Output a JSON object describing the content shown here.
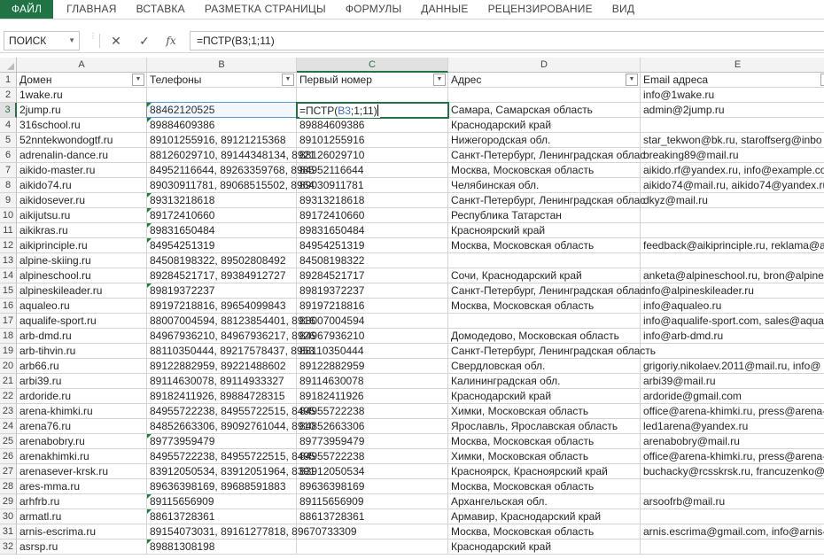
{
  "ribbon": {
    "tabs": [
      "ФАЙЛ",
      "ГЛАВНАЯ",
      "ВСТАВКА",
      "РАЗМЕТКА СТРАНИЦЫ",
      "ФОРМУЛЫ",
      "ДАННЫЕ",
      "РЕЦЕНЗИРОВАНИЕ",
      "ВИД"
    ]
  },
  "formula_bar": {
    "name_box": "ПОИСК",
    "cancel_icon": "close-icon",
    "enter_icon": "check-icon",
    "fx_label": "fx",
    "formula": "=ПСТР(B3;1;11)"
  },
  "sheet": {
    "columns": [
      "A",
      "B",
      "C",
      "D",
      "E"
    ],
    "selected_column": "C",
    "selected_row": 3,
    "active_cell": "C3",
    "colors": {
      "accent": "#217346",
      "reference": "#4472c4",
      "error_indicator": "#1e7b3a"
    },
    "headers": [
      "Домен",
      "Телефоны",
      "Первый номер",
      "Адрес",
      "Email адреса"
    ],
    "editing_formula": {
      "prefix": "=ПСТР(",
      "ref": "B3",
      "suffix": ";1;11)"
    },
    "rows": [
      {
        "n": 2,
        "a": "1wake.ru",
        "b": "",
        "c": "",
        "d": "",
        "e": "info@1wake.ru",
        "err": false
      },
      {
        "n": 3,
        "a": "2jump.ru",
        "b": "88462120525",
        "c": "",
        "d": "Самара, Самарская область",
        "e": "admin@2jump.ru",
        "err": true
      },
      {
        "n": 4,
        "a": "316school.ru",
        "b": "89884609386",
        "c": "89884609386",
        "d": "Краснодарский край",
        "e": "",
        "err": true
      },
      {
        "n": 5,
        "a": "52nntekwondogtf.ru",
        "b": "89101255916, 89121215368",
        "c": "89101255916",
        "d": "Нижегородская обл.",
        "e": "star_tekwon@bk.ru, staroffserg@inbo",
        "err": false
      },
      {
        "n": 6,
        "a": "adrenalin-dance.ru",
        "b": "88126029710, 89144348134, 8921",
        "c": "88126029710",
        "d": "Санкт-Петербург, Ленинградская облас",
        "e": "breaking89@mail.ru",
        "err": false
      },
      {
        "n": 7,
        "a": "aikido-master.ru",
        "b": "84952116644, 89263359768, 8985",
        "c": "84952116644",
        "d": "Москва, Московская область",
        "e": "aikido.rf@yandex.ru, info@example.co",
        "err": false
      },
      {
        "n": 8,
        "a": "aikido74.ru",
        "b": "89030911781, 89068515502, 8964",
        "c": "89030911781",
        "d": "Челябинская обл.",
        "e": "aikido74@mail.ru, aikido74@yandex.ru",
        "err": false
      },
      {
        "n": 9,
        "a": "aikidosever.ru",
        "b": "89313218618",
        "c": "89313218618",
        "d": "Санкт-Петербург, Ленинградская облас",
        "e": "dkyz@mail.ru",
        "err": true
      },
      {
        "n": 10,
        "a": "aikijutsu.ru",
        "b": "89172410660",
        "c": "89172410660",
        "d": "Республика Татарстан",
        "e": "",
        "err": true
      },
      {
        "n": 11,
        "a": "aikikras.ru",
        "b": "89831650484",
        "c": "89831650484",
        "d": "Красноярский край",
        "e": "",
        "err": true
      },
      {
        "n": 12,
        "a": "aikiprinciple.ru",
        "b": "84954251319",
        "c": "84954251319",
        "d": "Москва, Московская область",
        "e": "feedback@aikiprinciple.ru, reklama@a",
        "err": true
      },
      {
        "n": 13,
        "a": "alpine-skiing.ru",
        "b": "84508198322, 89502808492",
        "c": "84508198322",
        "d": "",
        "e": "",
        "err": false
      },
      {
        "n": 14,
        "a": "alpineschool.ru",
        "b": "89284521717, 89384912727",
        "c": "89284521717",
        "d": "Сочи, Краснодарский край",
        "e": "anketa@alpineschool.ru, bron@alpine",
        "err": false
      },
      {
        "n": 15,
        "a": "alpineskileader.ru",
        "b": "89819372237",
        "c": "89819372237",
        "d": "Санкт-Петербург, Ленинградская облас",
        "e": "info@alpineskileader.ru",
        "err": true
      },
      {
        "n": 16,
        "a": "aqualeo.ru",
        "b": "89197218816, 89654099843",
        "c": "89197218816",
        "d": "Москва, Московская область",
        "e": "info@aqualeo.ru",
        "err": false
      },
      {
        "n": 17,
        "a": "aqualife-sport.ru",
        "b": "88007004594, 88123854401, 8916",
        "c": "88007004594",
        "d": "",
        "e": "info@aqualife-sport.com, sales@aqua",
        "err": false
      },
      {
        "n": 18,
        "a": "arb-dmd.ru",
        "b": "84967936210, 84967936217, 8926",
        "c": "84967936210",
        "d": "Домодедово, Московская область",
        "e": "info@arb-dmd.ru",
        "err": false
      },
      {
        "n": 19,
        "a": "arb-tihvin.ru",
        "b": "88110350444, 89217578437, 8953",
        "c": "88110350444",
        "d": "Санкт-Петербург, Ленинградская область",
        "e": "",
        "err": false
      },
      {
        "n": 20,
        "a": "arb66.ru",
        "b": "89122882959, 89221488602",
        "c": "89122882959",
        "d": "Свердловская обл.",
        "e": "grigoriy.nikolaev.2011@mail.ru, info@",
        "err": false
      },
      {
        "n": 21,
        "a": "arbi39.ru",
        "b": "89114630078, 89114933327",
        "c": "89114630078",
        "d": "Калининградская обл.",
        "e": "arbi39@mail.ru",
        "err": false
      },
      {
        "n": 22,
        "a": "ardoride.ru",
        "b": "89182411926, 89884728315",
        "c": "89182411926",
        "d": "Краснодарский край",
        "e": "ardoride@gmail.com",
        "err": false
      },
      {
        "n": 23,
        "a": "arena-khimki.ru",
        "b": "84955722238, 84955722515, 8495",
        "c": "84955722238",
        "d": "Химки, Московская область",
        "e": "office@arena-khimki.ru, press@arena-",
        "err": false
      },
      {
        "n": 24,
        "a": "arena76.ru",
        "b": "84852663306, 89092761044, 8910",
        "c": "84852663306",
        "d": "Ярославль, Ярославская область",
        "e": "led1arena@yandex.ru",
        "err": false
      },
      {
        "n": 25,
        "a": "arenabobry.ru",
        "b": "89773959479",
        "c": "89773959479",
        "d": "Москва, Московская область",
        "e": "arenabobry@mail.ru",
        "err": true
      },
      {
        "n": 26,
        "a": "arenakhimki.ru",
        "b": "84955722238, 84955722515, 8495",
        "c": "84955722238",
        "d": "Химки, Московская область",
        "e": "office@arena-khimki.ru, press@arena-",
        "err": false
      },
      {
        "n": 27,
        "a": "arenasever-krsk.ru",
        "b": "83912050534, 83912051964, 8391",
        "c": "83912050534",
        "d": "Красноярск, Красноярский край",
        "e": "buchacky@rcsskrsk.ru, francuzenko@r",
        "err": false
      },
      {
        "n": 28,
        "a": "ares-mma.ru",
        "b": "89636398169, 89688591883",
        "c": "89636398169",
        "d": "Москва, Московская область",
        "e": "",
        "err": false
      },
      {
        "n": 29,
        "a": "arhfrb.ru",
        "b": "89115656909",
        "c": "89115656909",
        "d": "Архангельская обл.",
        "e": "arsoofrb@mail.ru",
        "err": true
      },
      {
        "n": 30,
        "a": "armatl.ru",
        "b": "88613728361",
        "c": "88613728361",
        "d": "Армавир, Краснодарский край",
        "e": "",
        "err": true
      },
      {
        "n": 31,
        "a": "arnis-escrima.ru",
        "b": "89154073031, 89161277818, 89670733309",
        "c": "",
        "d": "Москва, Московская область",
        "e": "arnis.escrima@gmail.com, info@arnis-",
        "err": false
      },
      {
        "n": 32,
        "a": "asrsp.ru",
        "b": "89881308198",
        "c": "",
        "d": "Краснодарский край",
        "e": "",
        "err": true
      }
    ]
  }
}
